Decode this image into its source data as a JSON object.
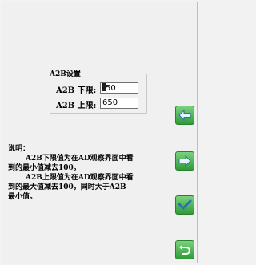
{
  "group": {
    "title": "A2B设置",
    "lower_label": "A2B 下限:",
    "lower_value": "50",
    "lower_value_prefix": "1",
    "upper_label": "A2B 上限:",
    "upper_value": "650"
  },
  "description": {
    "heading": "说明：",
    "line1": "A2B下限值为在AD观察界面中看",
    "line2": "到的最小值减去100。",
    "line3": "A2B上限值为在AD观察界面中看",
    "line4": "到的最大值减去100，同时大于A2B",
    "line5": "最小值。"
  },
  "buttons": {
    "back_icon": "arrow-left-icon",
    "next_icon": "arrow-right-icon",
    "confirm_icon": "check-icon",
    "return_icon": "return-icon",
    "accent_color": "#3aa843"
  }
}
